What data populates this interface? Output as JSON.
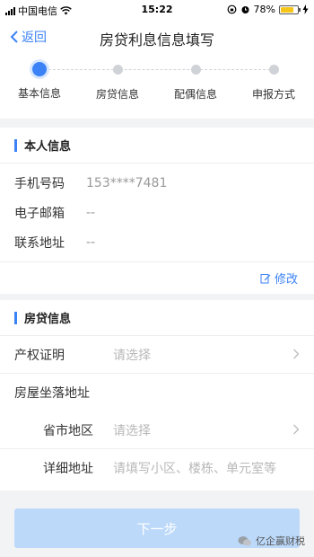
{
  "status_bar": {
    "carrier": "中国电信",
    "time": "15:22",
    "battery_percent": "78%",
    "battery_level": 0.78
  },
  "nav": {
    "back_label": "返回",
    "title": "房贷利息信息填写"
  },
  "steps": [
    {
      "label": "基本信息",
      "active": true
    },
    {
      "label": "房贷信息",
      "active": false
    },
    {
      "label": "配偶信息",
      "active": false
    },
    {
      "label": "申报方式",
      "active": false
    }
  ],
  "personal": {
    "title": "本人信息",
    "rows": [
      {
        "label": "手机号码",
        "value": "153****7481"
      },
      {
        "label": "电子邮箱",
        "value": "--"
      },
      {
        "label": "联系地址",
        "value": "--"
      }
    ],
    "edit_label": "修改"
  },
  "loan": {
    "title": "房贷信息",
    "property_cert_label": "产权证明",
    "property_cert_placeholder": "请选择",
    "house_address_label": "房屋坐落地址",
    "province_label": "省市地区",
    "province_placeholder": "请选择",
    "detail_label": "详细地址",
    "detail_placeholder": "请填写小区、楼栋、单元室等"
  },
  "next_button": "下一步",
  "watermark": "亿企赢财税",
  "colors": {
    "accent": "#3b82f6",
    "button_disabled": "#bcd9fa",
    "battery": "#f5c518"
  }
}
